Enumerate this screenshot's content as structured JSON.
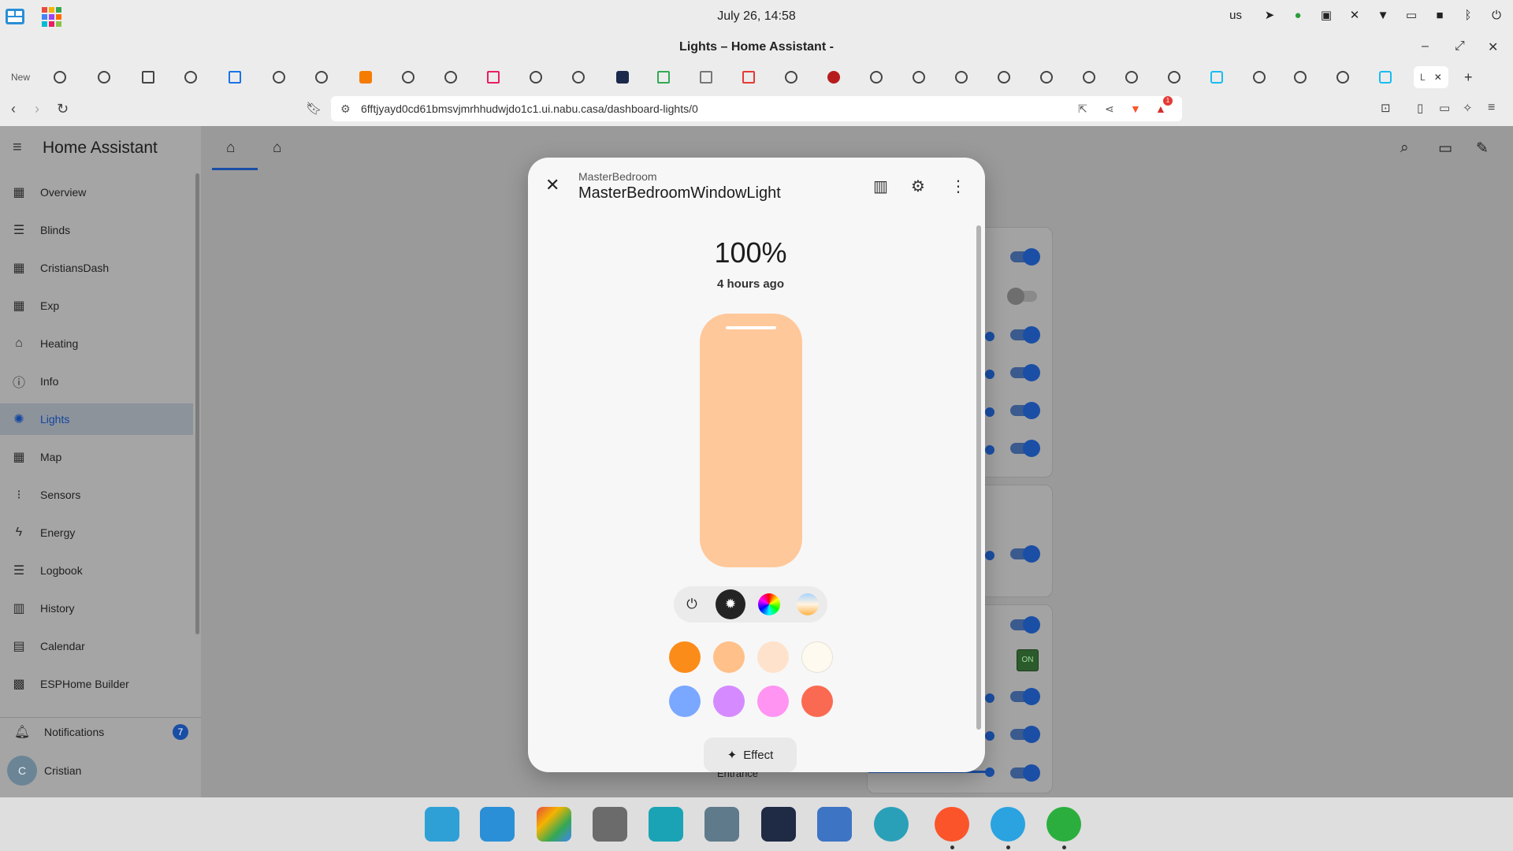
{
  "system": {
    "clock": "July 26, 14:58",
    "keyboard_layout": "us",
    "tray_icons": [
      "send-icon",
      "chrome-icon",
      "windows-icon",
      "mute-icon",
      "wifi-icon",
      "battery-icon",
      "chat-icon",
      "bluetooth-icon",
      "power-icon"
    ]
  },
  "window": {
    "title": "Lights – Home Assistant -"
  },
  "tabs": {
    "new_label": "New",
    "active_label": "L"
  },
  "nav": {
    "url": "6fftjyayd0cd61bmsvjmrhhudwjdo1c1.ui.nabu.casa/dashboard-lights/0",
    "brave_badge": "1"
  },
  "sidebar": {
    "title": "Home Assistant",
    "items": [
      {
        "label": "Overview",
        "icon": "dashboard-icon"
      },
      {
        "label": "Blinds",
        "icon": "blinds-icon"
      },
      {
        "label": "CristiansDash",
        "icon": "dashboard-icon"
      },
      {
        "label": "Exp",
        "icon": "dashboard-icon"
      },
      {
        "label": "Heating",
        "icon": "home-thermostat-icon"
      },
      {
        "label": "Info",
        "icon": "info-icon"
      },
      {
        "label": "Lights",
        "icon": "lightbulb-icon"
      },
      {
        "label": "Map",
        "icon": "dashboard-icon"
      },
      {
        "label": "Sensors",
        "icon": "sensors-icon"
      },
      {
        "label": "Energy",
        "icon": "lightning-icon"
      },
      {
        "label": "Logbook",
        "icon": "list-icon"
      },
      {
        "label": "History",
        "icon": "chart-icon"
      },
      {
        "label": "Calendar",
        "icon": "calendar-icon"
      },
      {
        "label": "ESPHome Builder",
        "icon": "chip-icon"
      }
    ],
    "selected": "Lights",
    "notifications_label": "Notifications",
    "notifications_count": "7",
    "user_name": "Cristian",
    "user_initial": "C"
  },
  "background": {
    "partial_label": "Entrance",
    "on_button": "ON"
  },
  "dialog": {
    "area": "MasterBedroom",
    "entity": "MasterBedroomWindowLight",
    "state": "100%",
    "last_changed": "4 hours ago",
    "brightness_level": 1.0,
    "slider_color": "#ffc89a",
    "modes": [
      {
        "name": "power-icon",
        "active": false
      },
      {
        "name": "brightness-icon",
        "active": true
      },
      {
        "name": "color-wheel-icon",
        "active": false
      },
      {
        "name": "color-temp-icon",
        "active": false
      }
    ],
    "favorite_colors": [
      "#fb8c19",
      "#ffc089",
      "#ffe2cc",
      "#fffaf0",
      "#7aa7ff",
      "#d58bff",
      "#ff94f2",
      "#fa6a52"
    ],
    "effect_label": "Effect"
  }
}
